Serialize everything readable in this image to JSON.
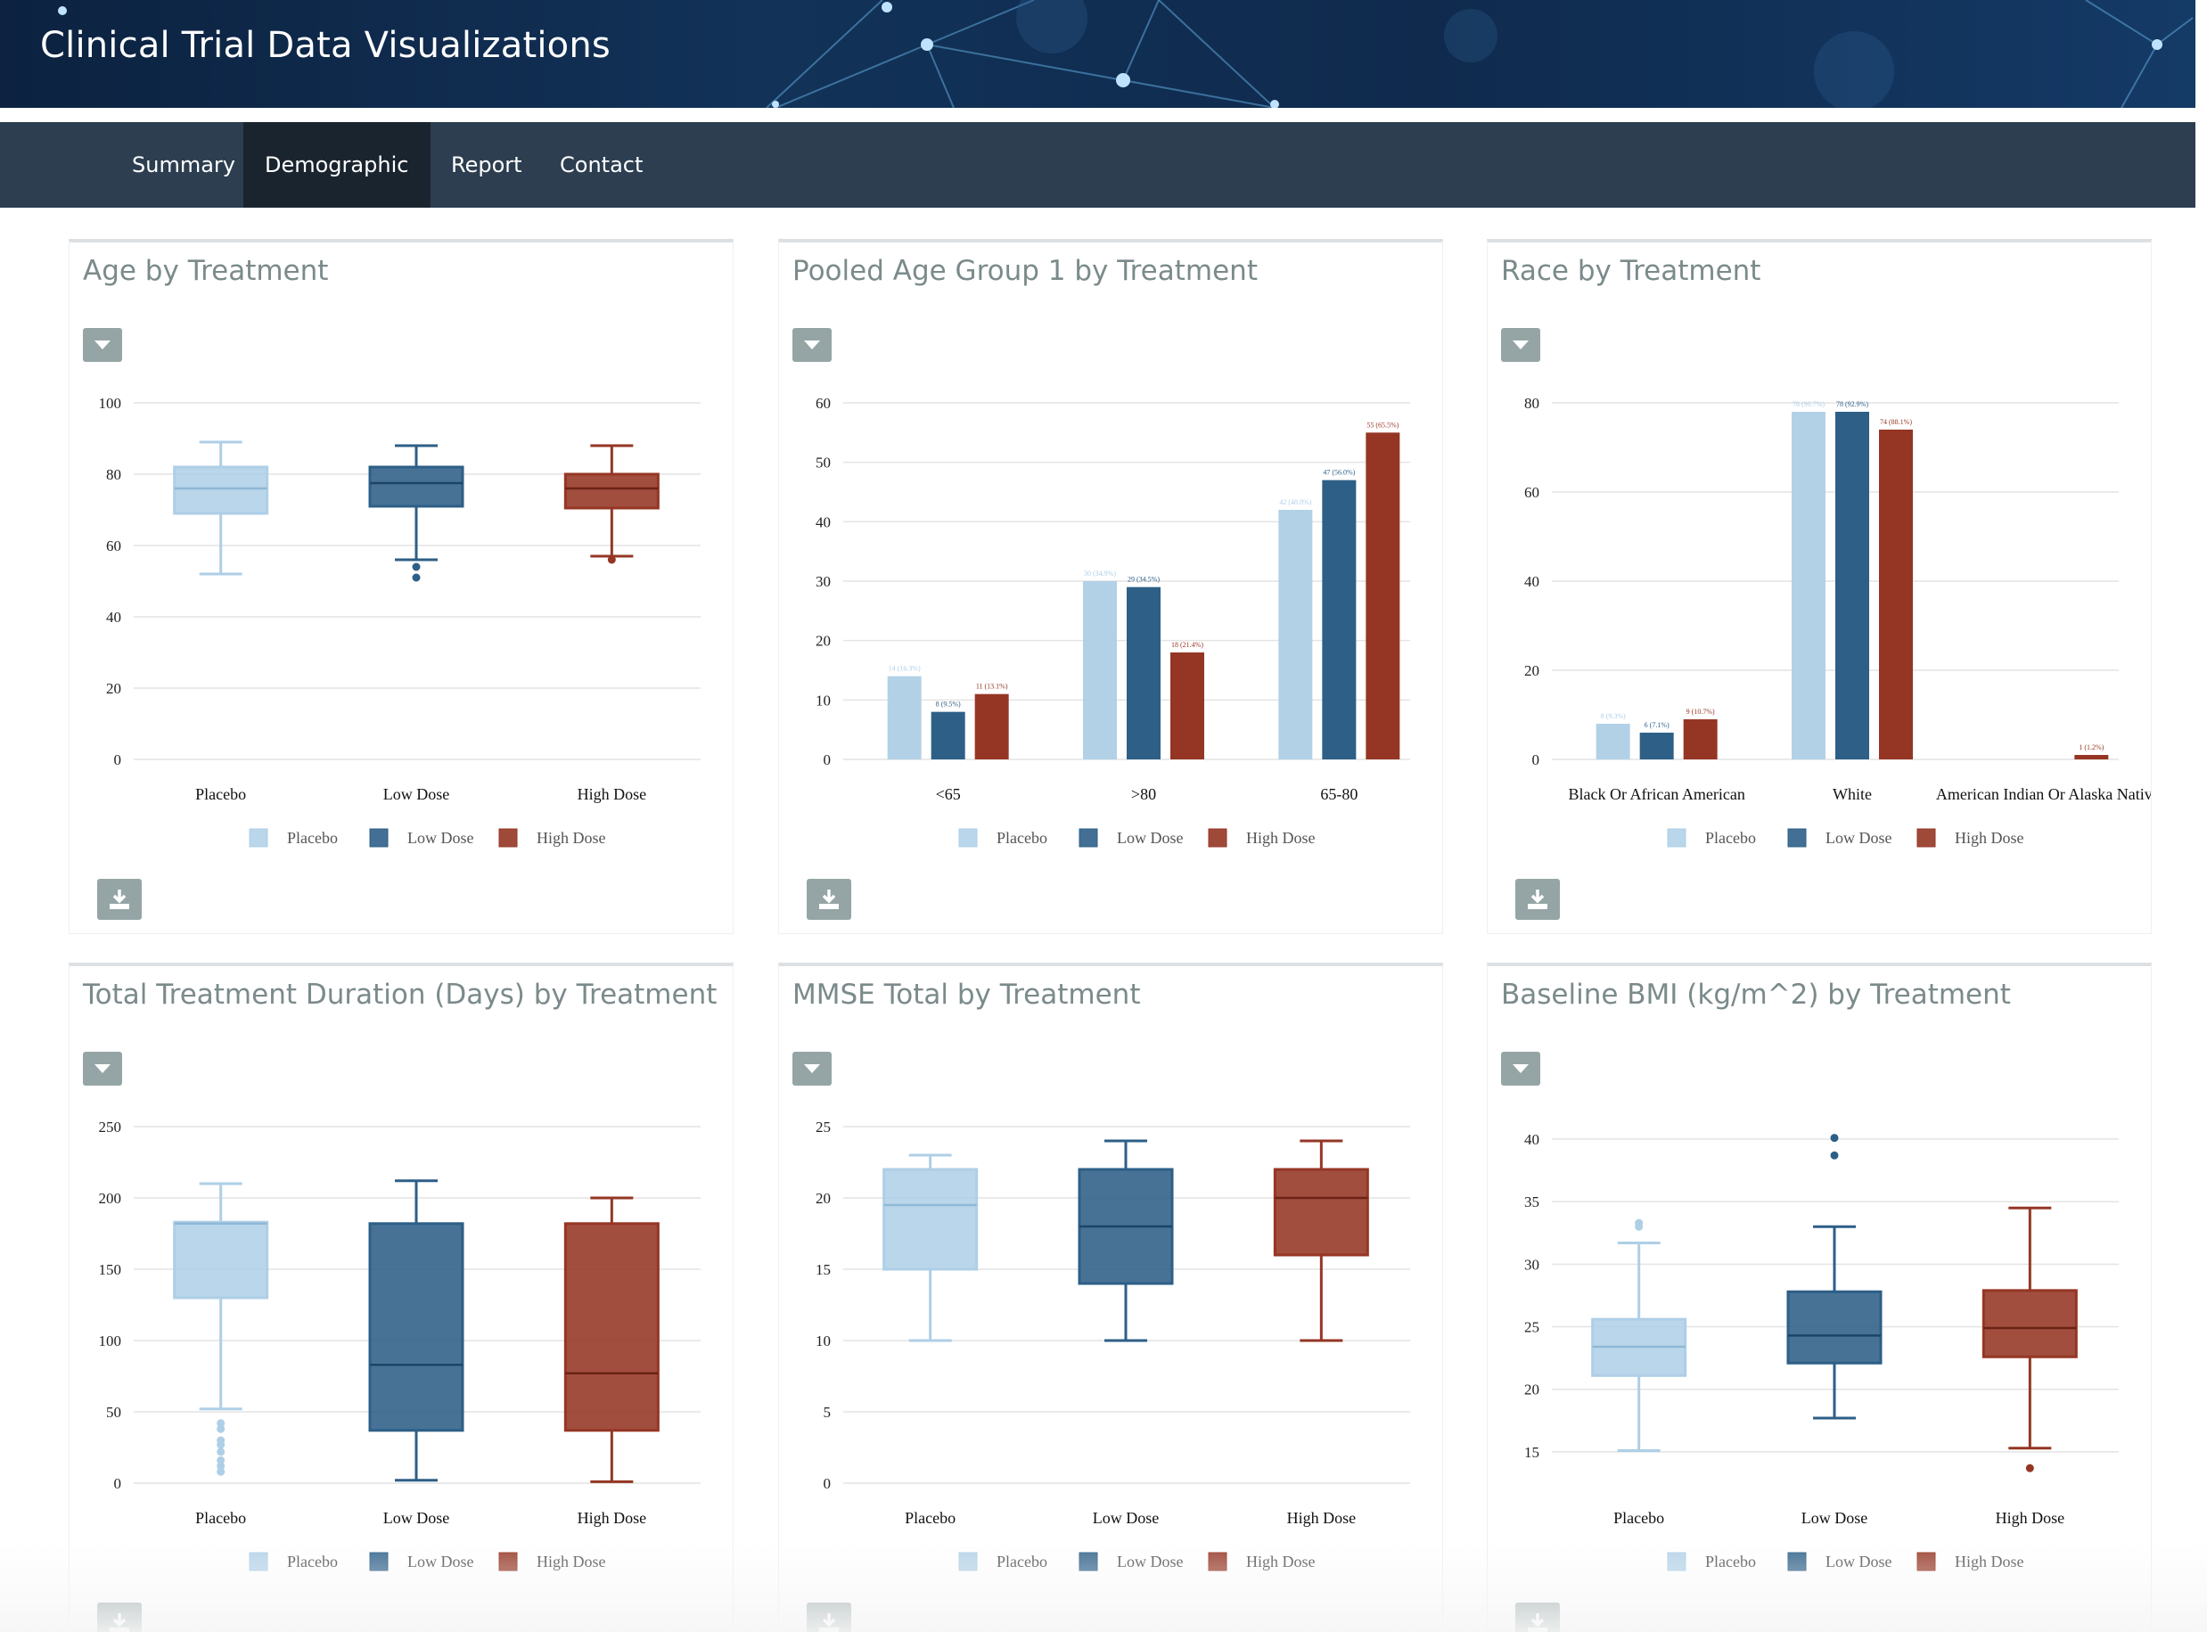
{
  "header": {
    "title": "Clinical Trial Data Visualizations"
  },
  "nav": {
    "items": [
      {
        "label": "Summary"
      },
      {
        "label": "Demographic"
      },
      {
        "label": "Report"
      },
      {
        "label": "Contact"
      }
    ]
  },
  "colors": {
    "placebo": "#aecfe6",
    "low_dose": "#2d5f87",
    "high_dose": "#953624"
  },
  "icons": {
    "panel_menu": "caret-down-icon",
    "download": "download-icon"
  },
  "panels": [
    {
      "title": "Age by Treatment"
    },
    {
      "title": "Pooled Age Group 1 by Treatment"
    },
    {
      "title": "Race by Treatment"
    },
    {
      "title": "Total Treatment Duration (Days) by Treatment"
    },
    {
      "title": "MMSE Total by Treatment"
    },
    {
      "title": "Baseline BMI (kg/m^2) by Treatment"
    }
  ],
  "chart_data": [
    {
      "type": "box",
      "categories": [
        "Placebo",
        "Low Dose",
        "High Dose"
      ],
      "yticks": [
        0,
        20,
        40,
        60,
        80,
        100
      ],
      "ylim": [
        0,
        100
      ],
      "legend": [
        "Placebo",
        "Low Dose",
        "High Dose"
      ],
      "legend_position": "bottom",
      "boxes": [
        {
          "min": 52,
          "q1": 69,
          "median": 76,
          "q3": 82,
          "max": 89,
          "outliers": []
        },
        {
          "min": 56,
          "q1": 71,
          "median": 77.5,
          "q3": 82,
          "max": 88,
          "outliers": [
            54,
            51
          ]
        },
        {
          "min": 57,
          "q1": 70.5,
          "median": 76,
          "q3": 80,
          "max": 88,
          "outliers": [
            56
          ]
        }
      ]
    },
    {
      "type": "bar",
      "categories": [
        "<65",
        ">80",
        "65-80"
      ],
      "yticks": [
        0,
        10,
        20,
        30,
        40,
        50,
        60
      ],
      "ylim": [
        0,
        60
      ],
      "legend_position": "bottom",
      "series": [
        {
          "name": "Placebo",
          "values": [
            14,
            30,
            42
          ],
          "labels": [
            "14 (16.3%)",
            "30 (34.9%)",
            "42 (48.8%)"
          ]
        },
        {
          "name": "Low Dose",
          "values": [
            8,
            29,
            47
          ],
          "labels": [
            "8 (9.5%)",
            "29 (34.5%)",
            "47 (56.0%)"
          ]
        },
        {
          "name": "High Dose",
          "values": [
            11,
            18,
            55
          ],
          "labels": [
            "11 (13.1%)",
            "18 (21.4%)",
            "55 (65.5%)"
          ]
        }
      ]
    },
    {
      "type": "bar",
      "categories": [
        "Black Or African American",
        "White",
        "American Indian Or Alaska Native"
      ],
      "yticks": [
        0,
        20,
        40,
        60,
        80
      ],
      "ylim": [
        0,
        80
      ],
      "legend_position": "bottom",
      "series": [
        {
          "name": "Placebo",
          "values": [
            8,
            78,
            0
          ],
          "labels": [
            "8 (9.3%)",
            "78 (90.7%)",
            ""
          ]
        },
        {
          "name": "Low Dose",
          "values": [
            6,
            78,
            0
          ],
          "labels": [
            "6 (7.1%)",
            "78 (92.9%)",
            ""
          ]
        },
        {
          "name": "High Dose",
          "values": [
            9,
            74,
            1
          ],
          "labels": [
            "9 (10.7%)",
            "74 (88.1%)",
            "1 (1.2%)"
          ]
        }
      ]
    },
    {
      "type": "box",
      "categories": [
        "Placebo",
        "Low Dose",
        "High Dose"
      ],
      "yticks": [
        0,
        50,
        100,
        150,
        200,
        250
      ],
      "ylim": [
        0,
        250
      ],
      "legend": [
        "Placebo",
        "Low Dose",
        "High Dose"
      ],
      "legend_position": "bottom",
      "boxes": [
        {
          "min": 52,
          "q1": 130,
          "median": 182,
          "q3": 183,
          "max": 210,
          "outliers": [
            42,
            38,
            30,
            27,
            22,
            16,
            12,
            8
          ]
        },
        {
          "min": 2,
          "q1": 37,
          "median": 83,
          "q3": 182,
          "max": 212,
          "outliers": []
        },
        {
          "min": 1,
          "q1": 37,
          "median": 77,
          "q3": 182,
          "max": 200,
          "outliers": []
        }
      ]
    },
    {
      "type": "box",
      "categories": [
        "Placebo",
        "Low Dose",
        "High Dose"
      ],
      "yticks": [
        0,
        5,
        10,
        15,
        20,
        25
      ],
      "ylim": [
        0,
        25
      ],
      "legend": [
        "Placebo",
        "Low Dose",
        "High Dose"
      ],
      "legend_position": "bottom",
      "boxes": [
        {
          "min": 10,
          "q1": 15,
          "median": 19.5,
          "q3": 22,
          "max": 23,
          "outliers": []
        },
        {
          "min": 10,
          "q1": 14,
          "median": 18,
          "q3": 22,
          "max": 24,
          "outliers": []
        },
        {
          "min": 10,
          "q1": 16,
          "median": 20,
          "q3": 22,
          "max": 24,
          "outliers": []
        }
      ]
    },
    {
      "type": "box",
      "categories": [
        "Placebo",
        "Low Dose",
        "High Dose"
      ],
      "yticks": [
        15,
        20,
        25,
        30,
        35,
        40
      ],
      "ylim": [
        12.5,
        41
      ],
      "legend": [
        "Placebo",
        "Low Dose",
        "High Dose"
      ],
      "legend_position": "bottom",
      "boxes": [
        {
          "min": 15.1,
          "q1": 21.1,
          "median": 23.4,
          "q3": 25.6,
          "max": 31.7,
          "outliers": [
            33.3,
            33.0
          ]
        },
        {
          "min": 17.7,
          "q1": 22.1,
          "median": 24.3,
          "q3": 27.8,
          "max": 33.0,
          "outliers": [
            40.1,
            38.7
          ]
        },
        {
          "min": 15.3,
          "q1": 22.6,
          "median": 24.9,
          "q3": 27.9,
          "max": 34.5,
          "outliers": [
            13.7
          ]
        }
      ]
    }
  ]
}
